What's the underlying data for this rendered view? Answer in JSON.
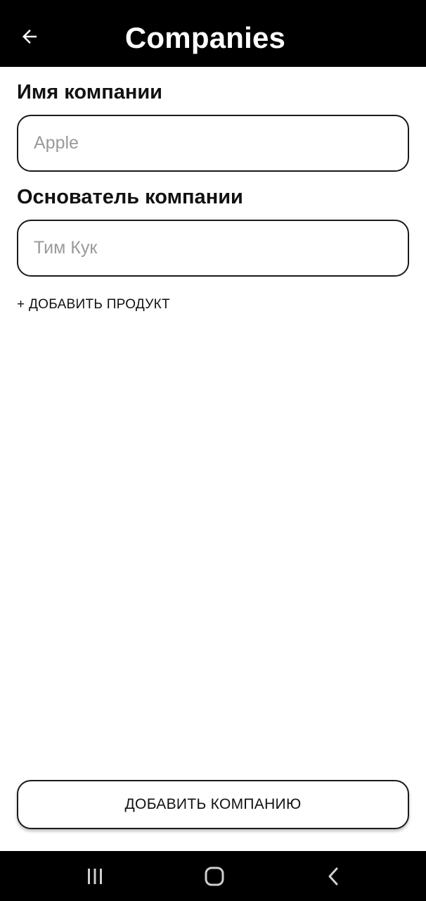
{
  "app_bar": {
    "title": "Companies",
    "back_icon": "arrow-left-icon"
  },
  "form": {
    "company_name": {
      "label": "Имя компании",
      "value": "",
      "placeholder": "Apple"
    },
    "company_founder": {
      "label": "Основатель компании",
      "value": "",
      "placeholder": "Тим Кук"
    },
    "add_product_label": "+ ДОБАВИТЬ ПРОДУКТ",
    "add_company_label": "ДОБАВИТЬ КОМПАНИЮ"
  },
  "nav_bar": {
    "items": [
      {
        "icon": "recent-apps-icon"
      },
      {
        "icon": "home-icon"
      },
      {
        "icon": "back-chevron-icon"
      }
    ]
  },
  "colors": {
    "bar_background": "#000000",
    "surface": "#ffffff",
    "text_primary": "#111111",
    "placeholder": "#9a9a9a"
  }
}
